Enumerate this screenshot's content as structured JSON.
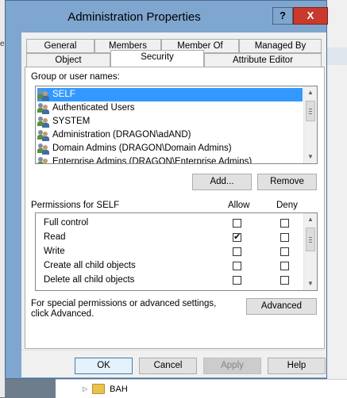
{
  "background": {
    "left_text": "ec",
    "tree_item": "BAH"
  },
  "window": {
    "title": "Administration Properties",
    "help_glyph": "?",
    "close_glyph": "X"
  },
  "tabs_row1": [
    "General",
    "Members",
    "Member Of",
    "Managed By"
  ],
  "tabs_row2": [
    "Object",
    "Security",
    "Attribute Editor"
  ],
  "active_tab": "Security",
  "groups": {
    "label": "Group or user names:",
    "items": [
      "SELF",
      "Authenticated Users",
      "SYSTEM",
      "Administration (DRAGON\\adAND)",
      "Domain Admins (DRAGON\\Domain Admins)",
      "Enterprise Admins (DRAGON\\Enterprise Admins)"
    ],
    "selected": "SELF"
  },
  "buttons": {
    "add": "Add...",
    "remove": "Remove",
    "advanced": "Advanced"
  },
  "permissions": {
    "label": "Permissions for SELF",
    "allow_header": "Allow",
    "deny_header": "Deny",
    "rows": [
      {
        "name": "Full control",
        "allow": false,
        "deny": false
      },
      {
        "name": "Read",
        "allow": true,
        "deny": false
      },
      {
        "name": "Write",
        "allow": false,
        "deny": false
      },
      {
        "name": "Create all child objects",
        "allow": false,
        "deny": false
      },
      {
        "name": "Delete all child objects",
        "allow": false,
        "deny": false
      }
    ]
  },
  "special_text": "For special permissions or advanced settings, click Advanced.",
  "footer": {
    "ok": "OK",
    "cancel": "Cancel",
    "apply": "Apply",
    "help": "Help"
  }
}
